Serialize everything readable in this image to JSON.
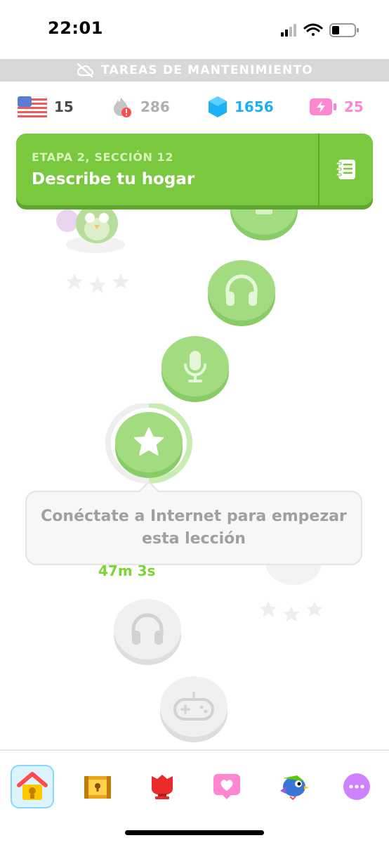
{
  "status_bar": {
    "time": "22:01"
  },
  "banner": {
    "text": "TAREAS DE MANTENIMIENTO",
    "icon": "cloud-off-icon"
  },
  "stats": {
    "language_icon": "us-flag-icon",
    "language_count": "15",
    "streak": "286",
    "gems": "1656",
    "energy": "25"
  },
  "unit": {
    "stage": "ETAPA 2, SECCIÓN 12",
    "title": "Describe tu hogar",
    "guide_icon": "notebook-icon"
  },
  "path": {
    "nodes": [
      {
        "icon": "book-icon",
        "state": "completed"
      },
      {
        "icon": "headphones-icon",
        "state": "completed"
      },
      {
        "icon": "microphone-icon",
        "state": "completed"
      },
      {
        "icon": "star-icon",
        "state": "current"
      },
      {
        "icon": "headphones-icon",
        "state": "locked"
      },
      {
        "icon": "gamepad-icon",
        "state": "locked"
      }
    ]
  },
  "tooltip": {
    "text": "Conéctate a Internet para empezar esta lección"
  },
  "timer": {
    "text": "47m 3s"
  },
  "bottom_nav": {
    "items": [
      {
        "icon": "home-icon",
        "active": true
      },
      {
        "icon": "treasure-chest-icon",
        "active": false
      },
      {
        "icon": "shield-icon",
        "active": false
      },
      {
        "icon": "heart-icon",
        "active": false
      },
      {
        "icon": "bird-icon",
        "active": false
      },
      {
        "icon": "more-icon",
        "active": false
      }
    ]
  },
  "colors": {
    "unit_green": "#79c83d",
    "node_green": "#a3dc80",
    "gems_blue": "#1cb0f6",
    "energy_pink": "#ff86d0",
    "nav_active": "#ddf4ff"
  }
}
